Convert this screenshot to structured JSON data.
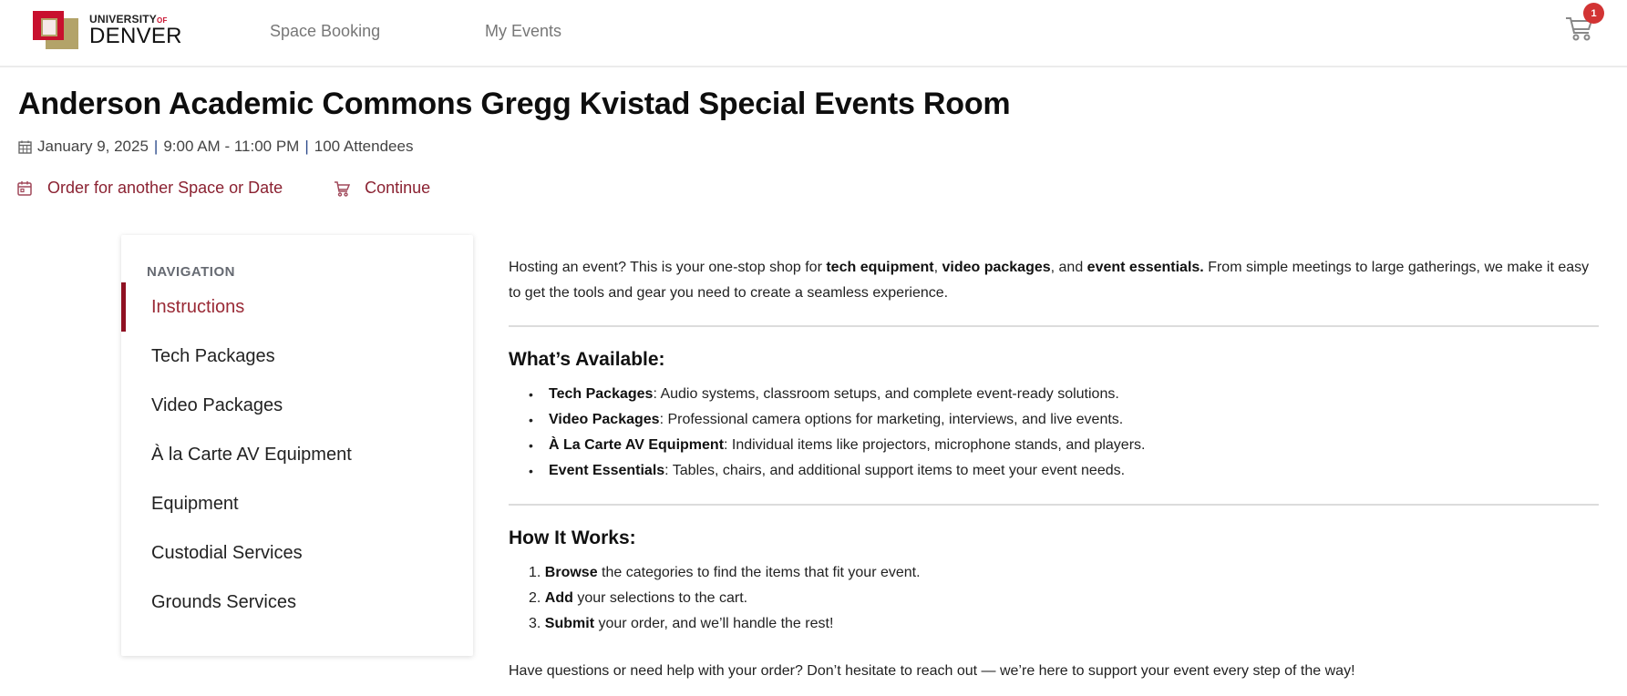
{
  "header": {
    "logo": {
      "line1": "UNIVERSITY",
      "line1_suffix": "OF",
      "line2": "DENVER"
    },
    "nav": [
      {
        "label": "Space Booking"
      },
      {
        "label": "My Events"
      }
    ],
    "cart": {
      "icon": "cart-icon",
      "badge_count": "1"
    }
  },
  "page": {
    "title": "Anderson Academic Commons Gregg Kvistad Special Events Room",
    "meta": {
      "icon": "calendar-grid-icon",
      "date": "January 9, 2025",
      "time": "9:00 AM - 11:00 PM",
      "attendees": "100 Attendees",
      "separator": "|"
    },
    "actions": [
      {
        "icon": "calendar-icon",
        "label": "Order for another Space or Date"
      },
      {
        "icon": "cart-icon",
        "label": "Continue"
      }
    ]
  },
  "sidebar": {
    "title": "NAVIGATION",
    "items": [
      {
        "label": "Instructions",
        "active": true
      },
      {
        "label": "Tech Packages"
      },
      {
        "label": "Video Packages"
      },
      {
        "label": "À la Carte AV Equipment"
      },
      {
        "label": "Equipment"
      },
      {
        "label": "Custodial Services"
      },
      {
        "label": "Grounds Services"
      }
    ]
  },
  "content": {
    "intro": {
      "p1": "Hosting an event? This is your one-stop shop for ",
      "b1": "tech equipment",
      "p2": ", ",
      "b2": "video packages",
      "p3": ", and ",
      "b3": "event essentials.",
      "p4": " From simple meetings to large gatherings, we make it easy to get the tools and gear you need to create a seamless experience."
    },
    "available": {
      "title": "What’s Available:",
      "items": [
        {
          "name": "Tech Packages",
          "desc": ": Audio systems, classroom setups, and complete event-ready solutions."
        },
        {
          "name": "Video Packages",
          "desc": ": Professional camera options for marketing, interviews, and live events."
        },
        {
          "name": "À La Carte AV Equipment",
          "desc": ": Individual items like projectors, microphone stands, and players."
        },
        {
          "name": "Event Essentials",
          "desc": ": Tables, chairs, and additional support items to meet your event needs."
        }
      ]
    },
    "how": {
      "title": "How It Works:",
      "steps": [
        {
          "num": "1.",
          "bold": "Browse",
          "rest": " the categories to find the items that fit your event."
        },
        {
          "num": "2.",
          "bold": "Add",
          "rest": " your selections to the cart."
        },
        {
          "num": "3.",
          "bold": "Submit",
          "rest": " your order, and we’ll handle the rest!"
        }
      ]
    },
    "footer_note": "Have questions or need help with your order? Don’t hesitate to reach out — we’re here to support your event every step of the way!"
  },
  "colors": {
    "brand_red": "#c8102e",
    "brand_gold": "#b3a369",
    "accent": "#8b2232",
    "badge": "#d23434"
  }
}
